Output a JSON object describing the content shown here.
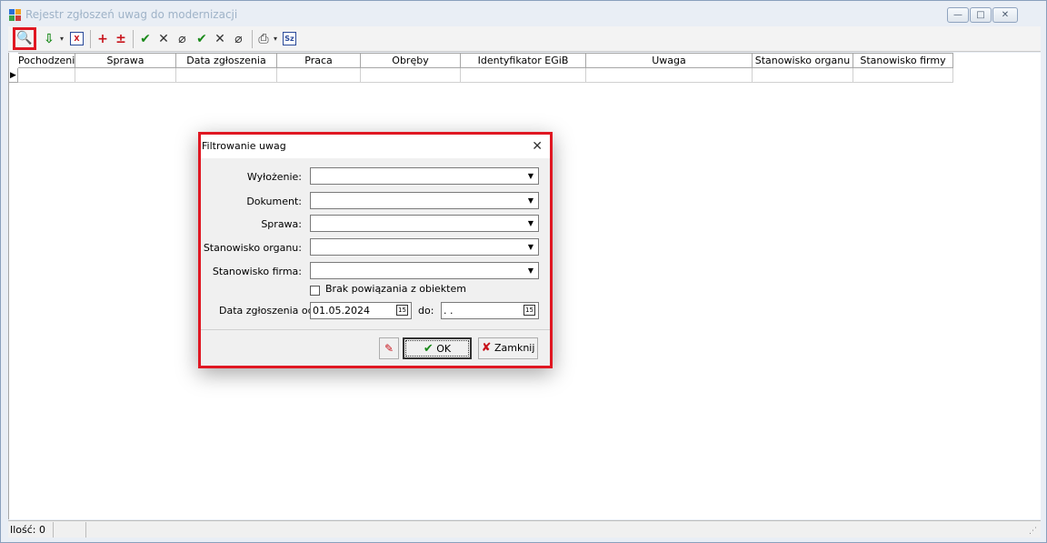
{
  "window": {
    "title": "Rejestr zgłoszeń uwag do modernizacji",
    "minimize_glyph": "—",
    "maximize_glyph": "□",
    "close_glyph": "✕"
  },
  "toolbar": {
    "find_icon": "binoculars-icon",
    "find_glyph": "🔍",
    "import_glyph": "⇩",
    "delete_doc_glyph": "X",
    "add_glyph": "+",
    "add_remove_glyph": "±",
    "accept_glyph": "✔",
    "reject_glyph": "✕",
    "erase_glyph": "⌀",
    "accept2_glyph": "✔",
    "reject2_glyph": "✕",
    "erase2_glyph": "⌀",
    "print_glyph": "⎙",
    "sz_label": "Sz",
    "dropdown_glyph": "▾"
  },
  "grid": {
    "columns": [
      "Pochodzenie",
      "Sprawa",
      "Data zgłoszenia",
      "Praca",
      "Obręby",
      "Identyfikator EGiB",
      "Uwaga",
      "Stanowisko organu",
      "Stanowisko firmy"
    ],
    "row_indicator": "▶"
  },
  "status": {
    "count_label": "Ilość: 0",
    "grip": "⋰"
  },
  "dialog": {
    "title": "Filtrowanie uwag",
    "close_glyph": "✕",
    "fields": [
      {
        "label": "Wyłożenie:",
        "value": ""
      },
      {
        "label": "Dokument:",
        "value": ""
      },
      {
        "label": "Sprawa:",
        "value": ""
      },
      {
        "label": "Stanowisko organu:",
        "value": ""
      },
      {
        "label": "Stanowisko firma:",
        "value": ""
      }
    ],
    "combo_arrow": "▼",
    "checkbox_label": "Brak powiązania z obiektem",
    "checkbox_checked": false,
    "date_label": "Data zgłoszenia od",
    "date_from": "01.05.2024",
    "date_to_label": "do:",
    "date_to": " .  .",
    "calendar_glyph": "15",
    "clear_glyph": "✎",
    "ok_label": "OK",
    "ok_glyph": "✔",
    "close_label": "Zamknij",
    "close_btn_glyph": "✘"
  }
}
